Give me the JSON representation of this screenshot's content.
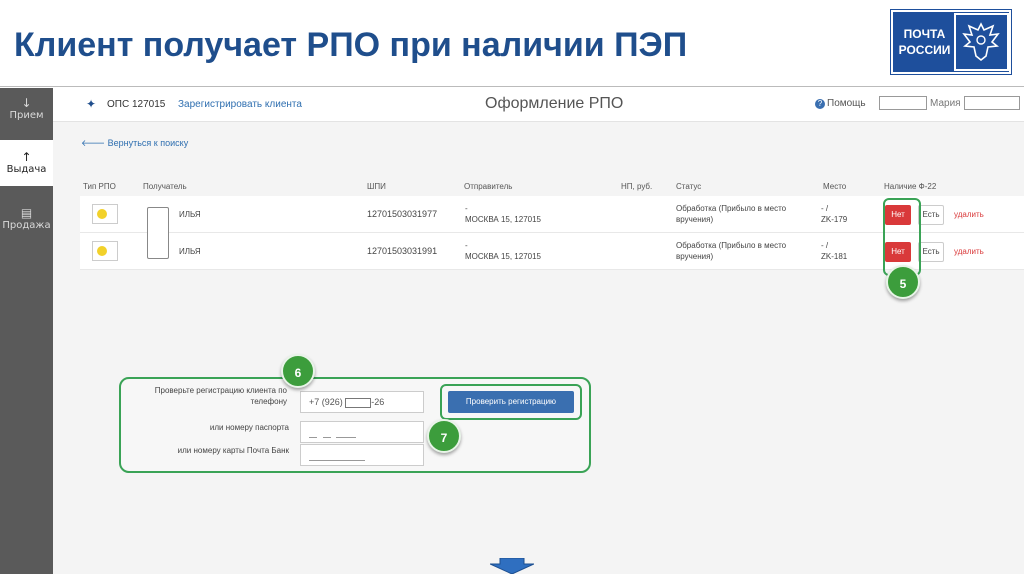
{
  "slide": {
    "title": "Клиент получает РПО при наличии ПЭП",
    "logo_line1": "ПОЧТА",
    "logo_line2": "РОССИИ"
  },
  "sidebar": {
    "items": [
      {
        "label": "Прием",
        "icon": "arrow-down-icon",
        "glyph": "↓"
      },
      {
        "label": "Выдача",
        "icon": "arrow-up-icon",
        "glyph": "↑"
      },
      {
        "label": "Продажа",
        "icon": "cart-icon",
        "glyph": "🛒"
      }
    ],
    "active_index": 1
  },
  "topbar": {
    "ops": "ОПС 127015",
    "register_link": "Зарегистрировать клиента",
    "title": "Оформление РПО",
    "help": "Помощь",
    "user": "Мария"
  },
  "back_link": "Вернуться к поиску",
  "table": {
    "headers": [
      "Тип РПО",
      "Получатель",
      "ШПИ",
      "Отправитель",
      "НП, руб.",
      "Статус",
      "Место",
      "Наличие Ф-22"
    ],
    "rows": [
      {
        "recipient": "ИЛЬЯ",
        "shpi": "12701503031977",
        "sender_line1": "-",
        "sender_line2": "МОСКВА 15, 127015",
        "status_line1": "Обработка (Прибыло в место",
        "status_line2": "вручения)",
        "place_line1": "- /",
        "place_line2": "ZK-179",
        "no_label": "Нет",
        "yes_label": "Есть",
        "delete_label": "удалить"
      },
      {
        "recipient": "ИЛЬЯ",
        "shpi": "12701503031991",
        "sender_line1": "-",
        "sender_line2": "МОСКВА 15, 127015",
        "status_line1": "Обработка (Прибыло в место",
        "status_line2": "вручения)",
        "place_line1": "- /",
        "place_line2": "ZK-181",
        "no_label": "Нет",
        "yes_label": "Есть",
        "delete_label": "удалить"
      }
    ]
  },
  "check": {
    "phone_label": "Проверьте регистрацию клиента по телефону",
    "phone_prefix": "+7 (926)",
    "phone_suffix": "-26",
    "passport_label": "или номеру паспорта",
    "card_label": "или номеру карты Почта Банк",
    "button_label": "Проверить регистрацию"
  },
  "callouts": {
    "five": "5",
    "six": "6",
    "seven": "7"
  },
  "colors": {
    "title": "#1f4e8c",
    "accent_green": "#3aa356",
    "danger": "#d9393a",
    "primary": "#3a6fb0"
  }
}
